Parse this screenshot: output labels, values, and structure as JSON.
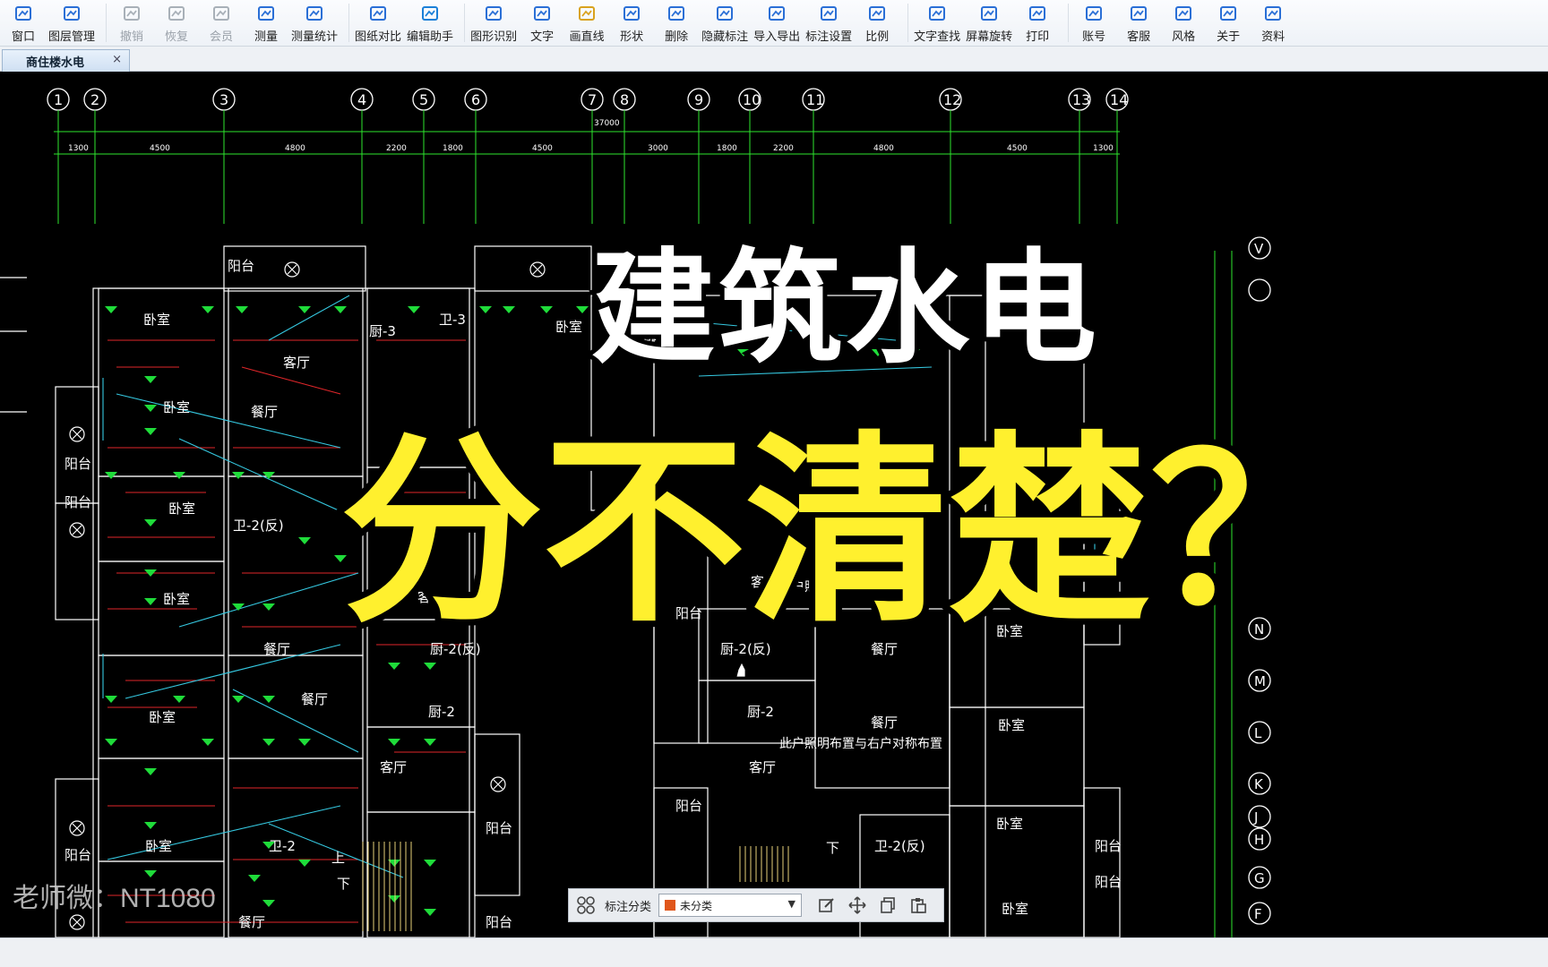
{
  "toolbar": {
    "items": [
      {
        "label": "窗口",
        "icon": "window-icon",
        "disabled": false
      },
      {
        "label": "图层管理",
        "icon": "layers-icon",
        "disabled": false
      },
      {
        "label": "撤销",
        "icon": "undo-icon",
        "disabled": true
      },
      {
        "label": "恢复",
        "icon": "redo-icon",
        "disabled": true
      },
      {
        "label": "会员",
        "icon": "vip-icon",
        "disabled": true
      },
      {
        "label": "测量",
        "icon": "measure-icon",
        "disabled": false
      },
      {
        "label": "测量统计",
        "icon": "measure-stats-icon",
        "disabled": false
      },
      {
        "label": "图纸对比",
        "icon": "compare-icon",
        "disabled": false
      },
      {
        "label": "编辑助手",
        "icon": "edit-assistant-icon",
        "disabled": false
      },
      {
        "label": "图形识别",
        "icon": "shape-recognize-icon",
        "disabled": false
      },
      {
        "label": "文字",
        "icon": "text-icon",
        "disabled": false
      },
      {
        "label": "画直线",
        "icon": "line-icon",
        "disabled": false
      },
      {
        "label": "形状",
        "icon": "shape-icon",
        "disabled": false
      },
      {
        "label": "删除",
        "icon": "eraser-icon",
        "disabled": false
      },
      {
        "label": "隐藏标注",
        "icon": "hide-annotation-icon",
        "disabled": false
      },
      {
        "label": "导入导出",
        "icon": "import-export-icon",
        "disabled": false
      },
      {
        "label": "标注设置",
        "icon": "annotation-settings-icon",
        "disabled": false
      },
      {
        "label": "比例",
        "icon": "scale-icon",
        "disabled": false
      },
      {
        "label": "文字查找",
        "icon": "text-search-icon",
        "disabled": false
      },
      {
        "label": "屏幕旋转",
        "icon": "rotate-screen-icon",
        "disabled": false
      },
      {
        "label": "打印",
        "icon": "print-icon",
        "disabled": false
      },
      {
        "label": "账号",
        "icon": "account-icon",
        "disabled": false
      },
      {
        "label": "客服",
        "icon": "support-icon",
        "disabled": false
      },
      {
        "label": "风格",
        "icon": "style-icon",
        "disabled": false
      },
      {
        "label": "关于",
        "icon": "about-icon",
        "disabled": false
      },
      {
        "label": "资料",
        "icon": "resources-icon",
        "disabled": false
      }
    ]
  },
  "tabs": {
    "active": "商住楼水电",
    "close_glyph": "×"
  },
  "drawing": {
    "axis_numbers": [
      "1",
      "2",
      "3",
      "4",
      "5",
      "6",
      "7",
      "8",
      "9",
      "10",
      "11",
      "12",
      "13",
      "14"
    ],
    "total_dimension": "37000",
    "dimensions": [
      "1300",
      "4500",
      "4800",
      "2200",
      "1800",
      "4500",
      "3000",
      "1800",
      "2200",
      "4800",
      "4500",
      "1300"
    ],
    "right_axis_letters": [
      "V",
      "N",
      "M",
      "L",
      "K",
      "J",
      "H",
      "G",
      "F"
    ],
    "room_labels": {
      "balcony": "阳台",
      "bedroom": "卧室",
      "living": "客厅",
      "dining": "餐厅",
      "kitchen3": "厨-3",
      "kitchen2": "厨-2",
      "kitchen2_mirror": "厨-2(反)",
      "bath2": "卫-2",
      "bath2_mirror": "卫-2(反)",
      "bath3": "卫-3",
      "up": "上",
      "down": "下"
    },
    "notes": [
      "此户照明布置与右户对称布置",
      "此户照明布置与右户"
    ]
  },
  "overlay": {
    "headline_top": "建筑水电",
    "headline_bottom": "分不清楚？"
  },
  "annotation_bar": {
    "label": "标注分类",
    "selected": "未分类",
    "swatch_color": "#e0561b"
  },
  "watermark": "老师微：NT1080",
  "colors": {
    "wall": "#ffffff",
    "axis_green": "#2ee62e",
    "wire_red": "#e0262a",
    "wire_cyan": "#35c8e0",
    "fixture_green": "#1fdc3a",
    "headline_yellow": "#fff02e"
  }
}
